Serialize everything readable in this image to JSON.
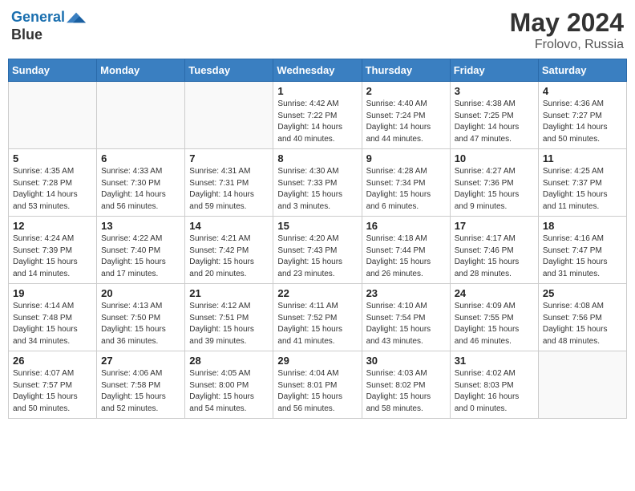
{
  "header": {
    "logo_line1": "General",
    "logo_line2": "Blue",
    "month_year": "May 2024",
    "location": "Frolovo, Russia"
  },
  "days_of_week": [
    "Sunday",
    "Monday",
    "Tuesday",
    "Wednesday",
    "Thursday",
    "Friday",
    "Saturday"
  ],
  "weeks": [
    [
      {
        "num": "",
        "info": ""
      },
      {
        "num": "",
        "info": ""
      },
      {
        "num": "",
        "info": ""
      },
      {
        "num": "1",
        "info": "Sunrise: 4:42 AM\nSunset: 7:22 PM\nDaylight: 14 hours\nand 40 minutes."
      },
      {
        "num": "2",
        "info": "Sunrise: 4:40 AM\nSunset: 7:24 PM\nDaylight: 14 hours\nand 44 minutes."
      },
      {
        "num": "3",
        "info": "Sunrise: 4:38 AM\nSunset: 7:25 PM\nDaylight: 14 hours\nand 47 minutes."
      },
      {
        "num": "4",
        "info": "Sunrise: 4:36 AM\nSunset: 7:27 PM\nDaylight: 14 hours\nand 50 minutes."
      }
    ],
    [
      {
        "num": "5",
        "info": "Sunrise: 4:35 AM\nSunset: 7:28 PM\nDaylight: 14 hours\nand 53 minutes."
      },
      {
        "num": "6",
        "info": "Sunrise: 4:33 AM\nSunset: 7:30 PM\nDaylight: 14 hours\nand 56 minutes."
      },
      {
        "num": "7",
        "info": "Sunrise: 4:31 AM\nSunset: 7:31 PM\nDaylight: 14 hours\nand 59 minutes."
      },
      {
        "num": "8",
        "info": "Sunrise: 4:30 AM\nSunset: 7:33 PM\nDaylight: 15 hours\nand 3 minutes."
      },
      {
        "num": "9",
        "info": "Sunrise: 4:28 AM\nSunset: 7:34 PM\nDaylight: 15 hours\nand 6 minutes."
      },
      {
        "num": "10",
        "info": "Sunrise: 4:27 AM\nSunset: 7:36 PM\nDaylight: 15 hours\nand 9 minutes."
      },
      {
        "num": "11",
        "info": "Sunrise: 4:25 AM\nSunset: 7:37 PM\nDaylight: 15 hours\nand 11 minutes."
      }
    ],
    [
      {
        "num": "12",
        "info": "Sunrise: 4:24 AM\nSunset: 7:39 PM\nDaylight: 15 hours\nand 14 minutes."
      },
      {
        "num": "13",
        "info": "Sunrise: 4:22 AM\nSunset: 7:40 PM\nDaylight: 15 hours\nand 17 minutes."
      },
      {
        "num": "14",
        "info": "Sunrise: 4:21 AM\nSunset: 7:42 PM\nDaylight: 15 hours\nand 20 minutes."
      },
      {
        "num": "15",
        "info": "Sunrise: 4:20 AM\nSunset: 7:43 PM\nDaylight: 15 hours\nand 23 minutes."
      },
      {
        "num": "16",
        "info": "Sunrise: 4:18 AM\nSunset: 7:44 PM\nDaylight: 15 hours\nand 26 minutes."
      },
      {
        "num": "17",
        "info": "Sunrise: 4:17 AM\nSunset: 7:46 PM\nDaylight: 15 hours\nand 28 minutes."
      },
      {
        "num": "18",
        "info": "Sunrise: 4:16 AM\nSunset: 7:47 PM\nDaylight: 15 hours\nand 31 minutes."
      }
    ],
    [
      {
        "num": "19",
        "info": "Sunrise: 4:14 AM\nSunset: 7:48 PM\nDaylight: 15 hours\nand 34 minutes."
      },
      {
        "num": "20",
        "info": "Sunrise: 4:13 AM\nSunset: 7:50 PM\nDaylight: 15 hours\nand 36 minutes."
      },
      {
        "num": "21",
        "info": "Sunrise: 4:12 AM\nSunset: 7:51 PM\nDaylight: 15 hours\nand 39 minutes."
      },
      {
        "num": "22",
        "info": "Sunrise: 4:11 AM\nSunset: 7:52 PM\nDaylight: 15 hours\nand 41 minutes."
      },
      {
        "num": "23",
        "info": "Sunrise: 4:10 AM\nSunset: 7:54 PM\nDaylight: 15 hours\nand 43 minutes."
      },
      {
        "num": "24",
        "info": "Sunrise: 4:09 AM\nSunset: 7:55 PM\nDaylight: 15 hours\nand 46 minutes."
      },
      {
        "num": "25",
        "info": "Sunrise: 4:08 AM\nSunset: 7:56 PM\nDaylight: 15 hours\nand 48 minutes."
      }
    ],
    [
      {
        "num": "26",
        "info": "Sunrise: 4:07 AM\nSunset: 7:57 PM\nDaylight: 15 hours\nand 50 minutes."
      },
      {
        "num": "27",
        "info": "Sunrise: 4:06 AM\nSunset: 7:58 PM\nDaylight: 15 hours\nand 52 minutes."
      },
      {
        "num": "28",
        "info": "Sunrise: 4:05 AM\nSunset: 8:00 PM\nDaylight: 15 hours\nand 54 minutes."
      },
      {
        "num": "29",
        "info": "Sunrise: 4:04 AM\nSunset: 8:01 PM\nDaylight: 15 hours\nand 56 minutes."
      },
      {
        "num": "30",
        "info": "Sunrise: 4:03 AM\nSunset: 8:02 PM\nDaylight: 15 hours\nand 58 minutes."
      },
      {
        "num": "31",
        "info": "Sunrise: 4:02 AM\nSunset: 8:03 PM\nDaylight: 16 hours\nand 0 minutes."
      },
      {
        "num": "",
        "info": ""
      }
    ]
  ]
}
